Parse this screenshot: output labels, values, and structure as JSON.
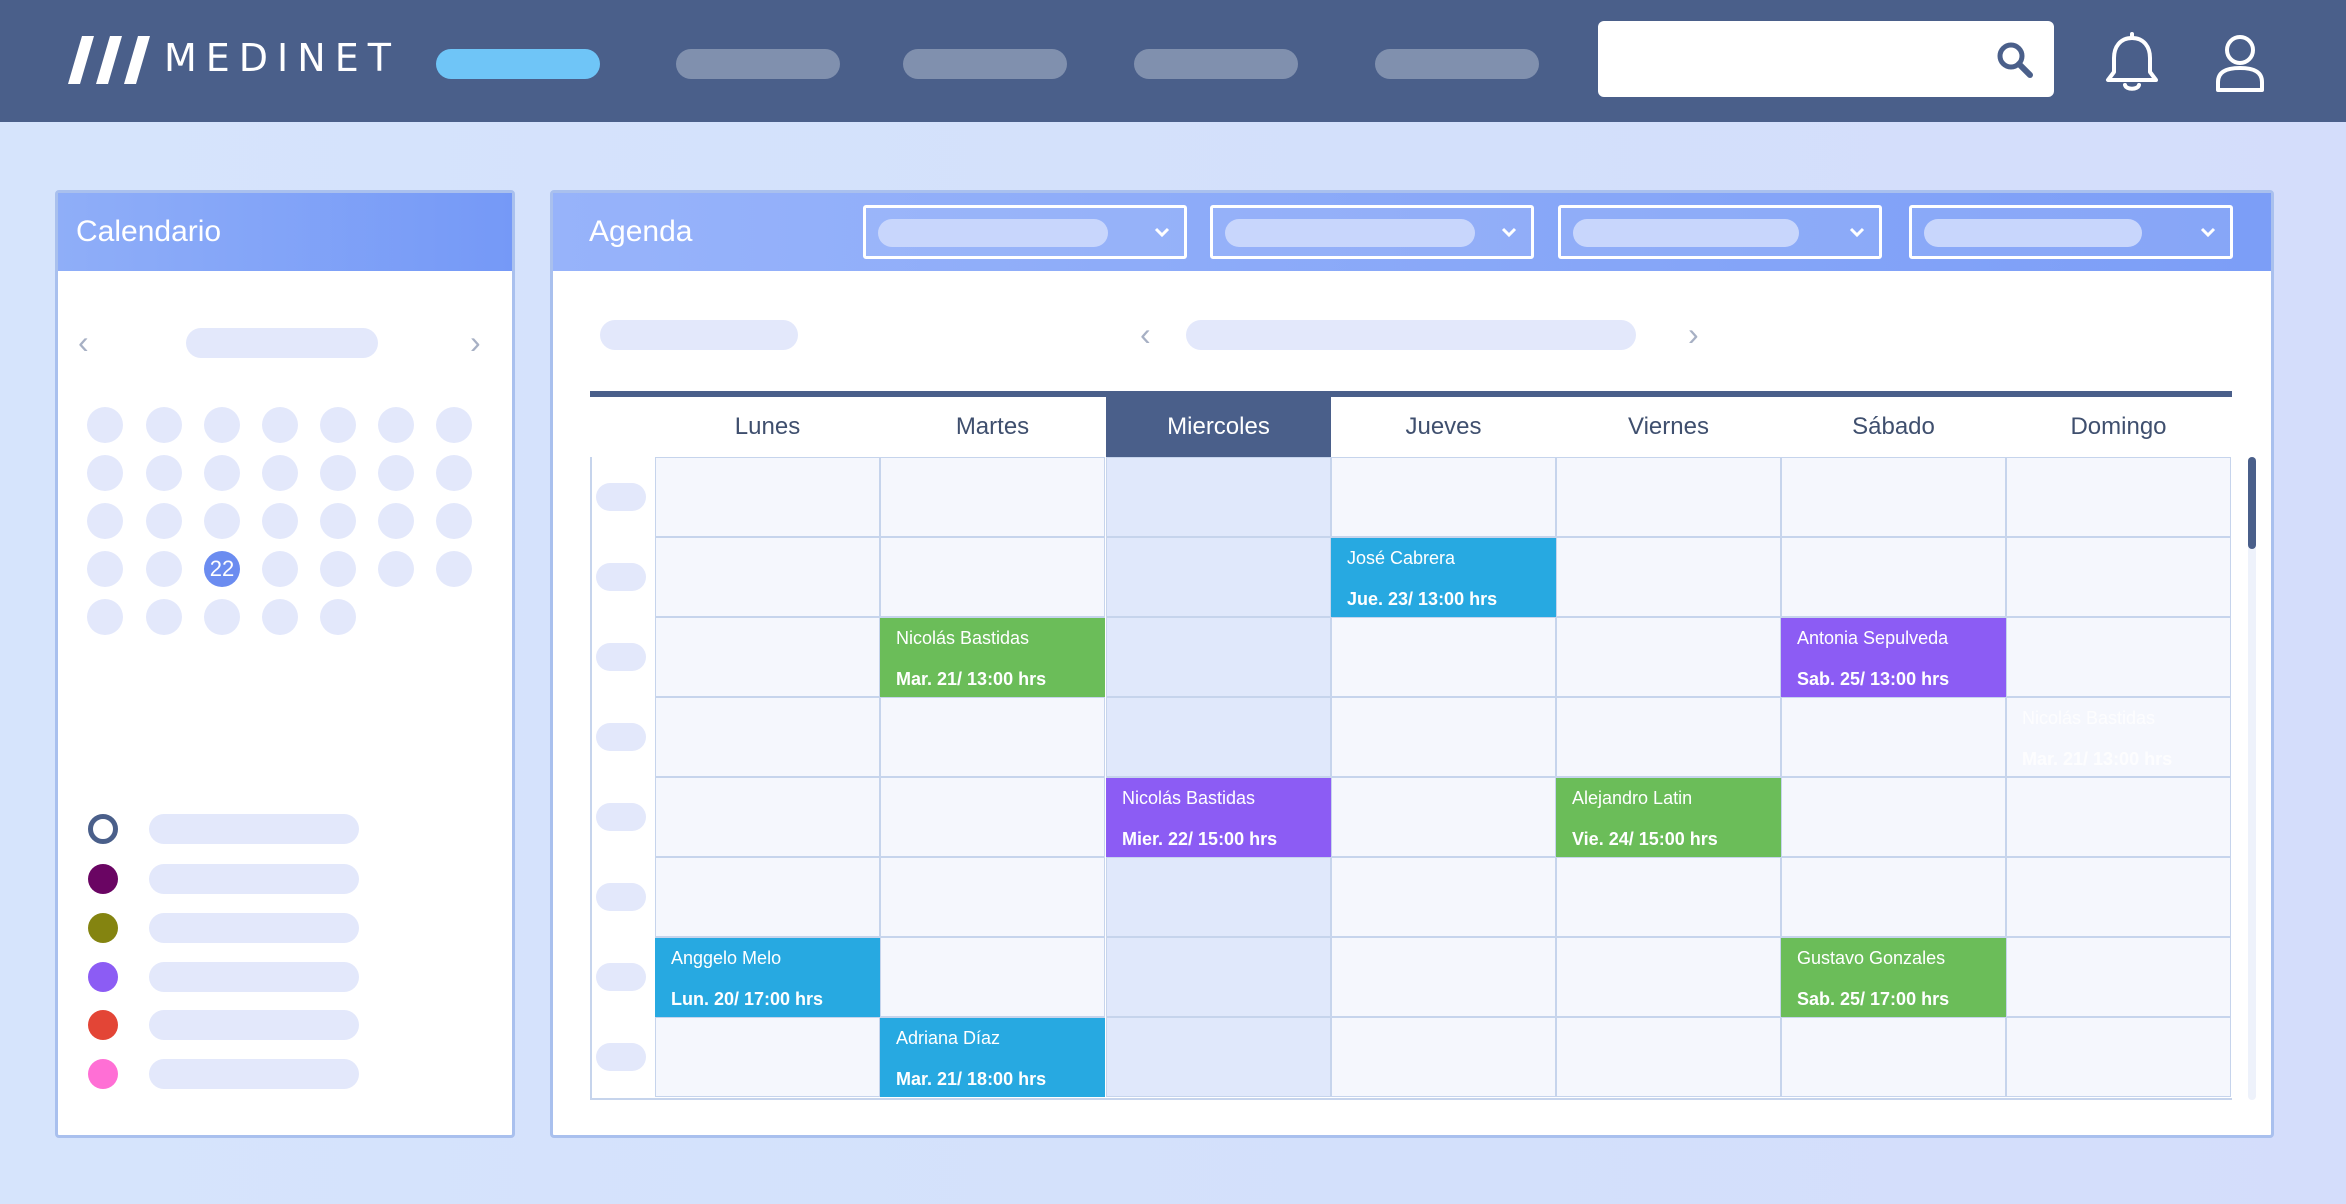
{
  "brand": {
    "name": "MEDINET"
  },
  "nav": {
    "items": [
      "",
      "",
      "",
      "",
      ""
    ],
    "active_index": 0
  },
  "search": {
    "value": "",
    "placeholder": ""
  },
  "icons": {
    "search": "search-icon",
    "bell": "bell-icon",
    "user": "user-icon",
    "prev": "chevron-left-icon",
    "next": "chevron-right-icon",
    "dropdown": "chevron-down-icon"
  },
  "calendar": {
    "title": "Calendario",
    "selected_day": "22",
    "legend_colors": [
      "#4a5f8a",
      "#6a0563",
      "#848410",
      "#8c5cf4",
      "#e34536",
      "#ff6fd5"
    ]
  },
  "agenda": {
    "title": "Agenda",
    "days": [
      "Lunes",
      "Martes",
      "Miercoles",
      "Jueves",
      "Viernes",
      "Sábado",
      "Domingo"
    ],
    "today_index": 2,
    "appointments": [
      {
        "name": "José Cabrera",
        "time": "Jue. 23/ 13:00 hrs"
      },
      {
        "name": "Nicolás Bastidas",
        "time": "Mar. 21/ 13:00 hrs"
      },
      {
        "name": "Antonia Sepulveda",
        "time": "Sab. 25/ 13:00 hrs"
      },
      {
        "name": "Nicolás Bastidas",
        "time": "Mar. 21/ 13:00 hrs"
      },
      {
        "name": "Nicolás Bastidas",
        "time": "Mier. 22/ 15:00 hrs"
      },
      {
        "name": "Alejandro Latin",
        "time": "Vie. 24/ 15:00 hrs"
      },
      {
        "name": "Anggelo Melo",
        "time": "Lun. 20/ 17:00 hrs"
      },
      {
        "name": "Gustavo Gonzales",
        "time": "Sab. 25/ 17:00 hrs"
      },
      {
        "name": "Adriana Díaz",
        "time": "Mar. 21/ 18:00 hrs"
      }
    ]
  },
  "colors": {
    "accent": "#6fc5f7",
    "header": "#4a5f8a",
    "appt_blue": "#27a9e1",
    "appt_green": "#6bbd59",
    "appt_purple": "#8c5cf4"
  }
}
